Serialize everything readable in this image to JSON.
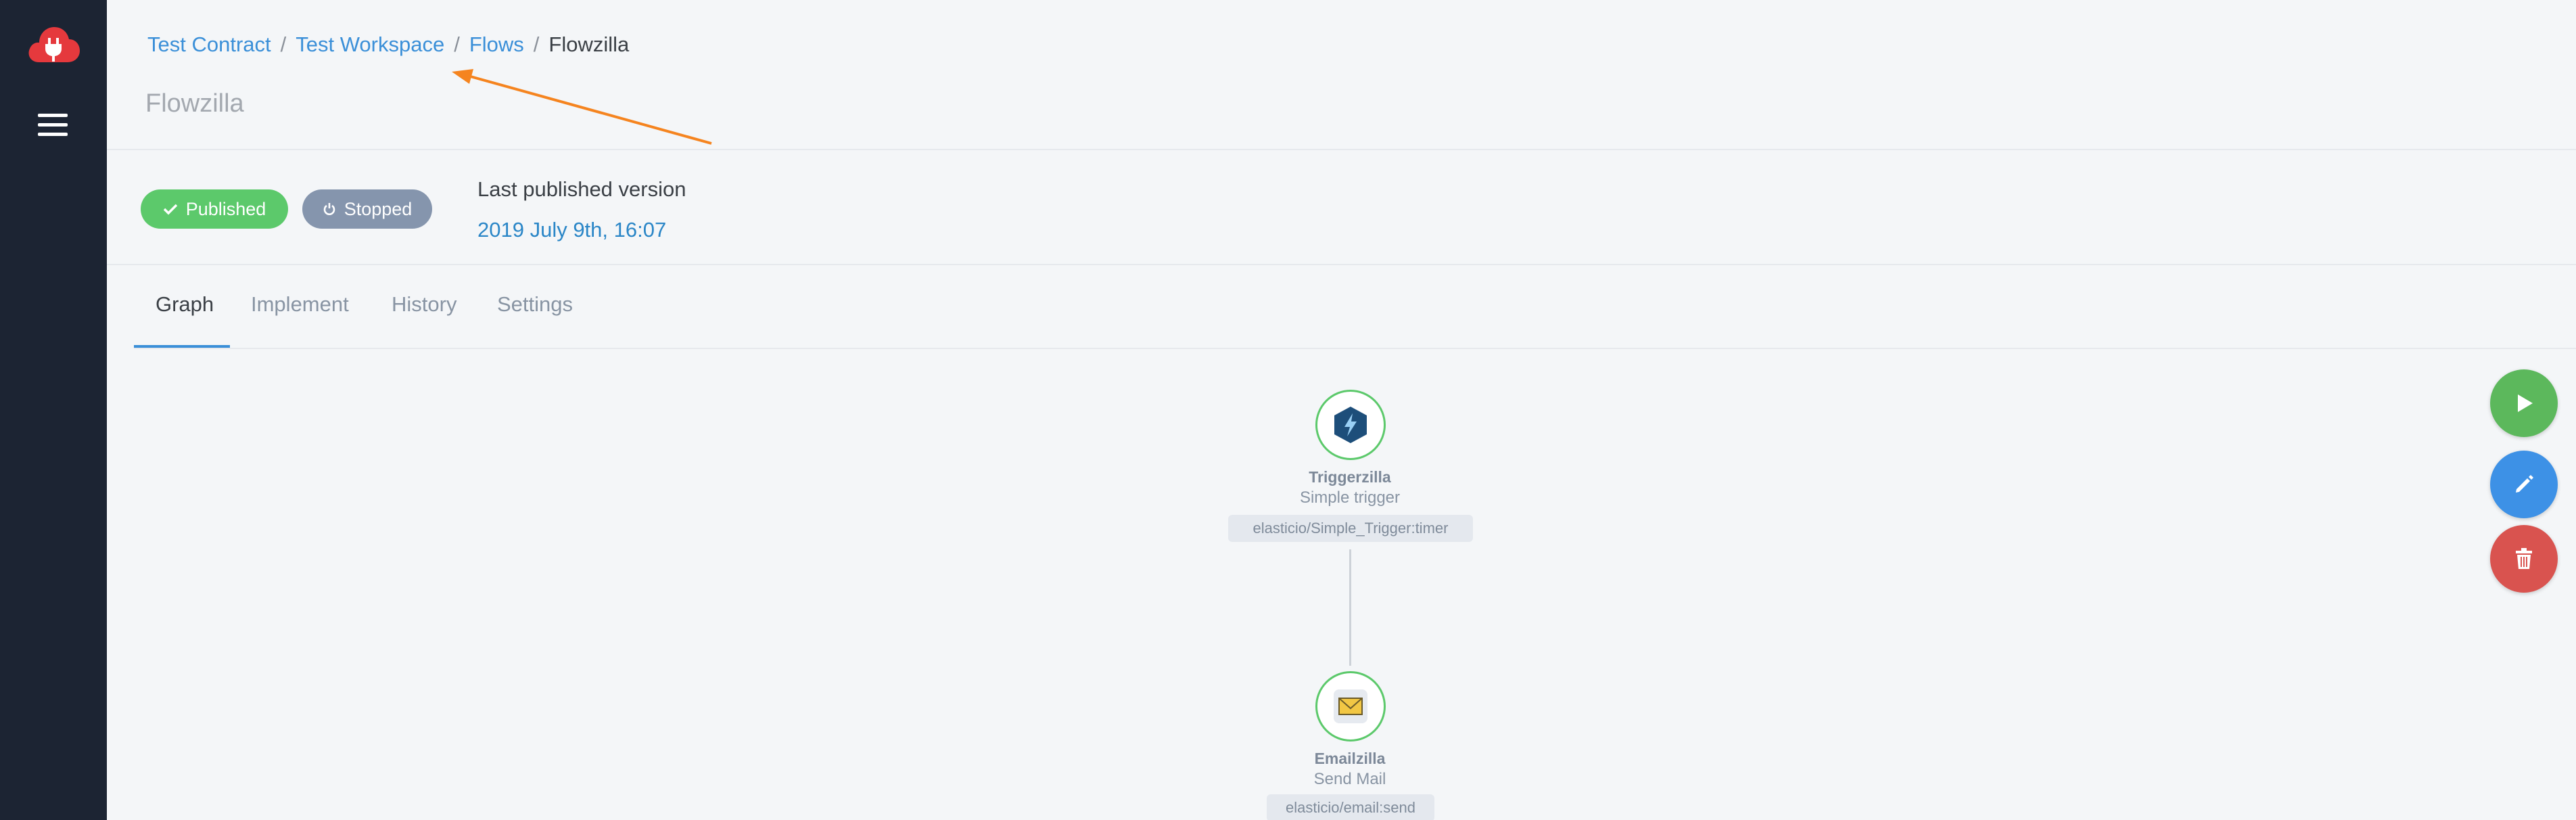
{
  "sidebar": {
    "logo_icon": "cloud-plug-logo",
    "menu_icon": "hamburger-menu-icon"
  },
  "breadcrumb": {
    "items": [
      "Test Contract",
      "Test Workspace",
      "Flows"
    ],
    "separator": "/",
    "current": "Flowzilla"
  },
  "page": {
    "title": "Flowzilla"
  },
  "status": {
    "published_label": "Published",
    "stopped_label": "Stopped",
    "last_published_label": "Last published version",
    "last_published_date": "2019 July 9th, 16:07"
  },
  "tabs": [
    {
      "label": "Graph",
      "active": true
    },
    {
      "label": "Implement",
      "active": false
    },
    {
      "label": "History",
      "active": false
    },
    {
      "label": "Settings",
      "active": false
    }
  ],
  "graph": {
    "nodes": [
      {
        "name": "Triggerzilla",
        "subtitle": "Simple trigger",
        "tag": "elasticio/Simple_Trigger:timer",
        "icon": "lightning-hexagon-icon"
      },
      {
        "name": "Emailzilla",
        "subtitle": "Send Mail",
        "tag": "elasticio/email:send",
        "icon": "email-envelope-icon"
      }
    ]
  },
  "actions": {
    "run_icon": "play-icon",
    "edit_icon": "pencil-icon",
    "delete_icon": "trash-icon"
  },
  "colors": {
    "sidebar": "#1c2433",
    "link": "#3a8fd8",
    "published": "#5cc96b",
    "stopped": "#8595ad",
    "run": "#5cb85c",
    "edit": "#3d91e6",
    "delete": "#d9534f",
    "annotation_arrow": "#f5841f"
  }
}
